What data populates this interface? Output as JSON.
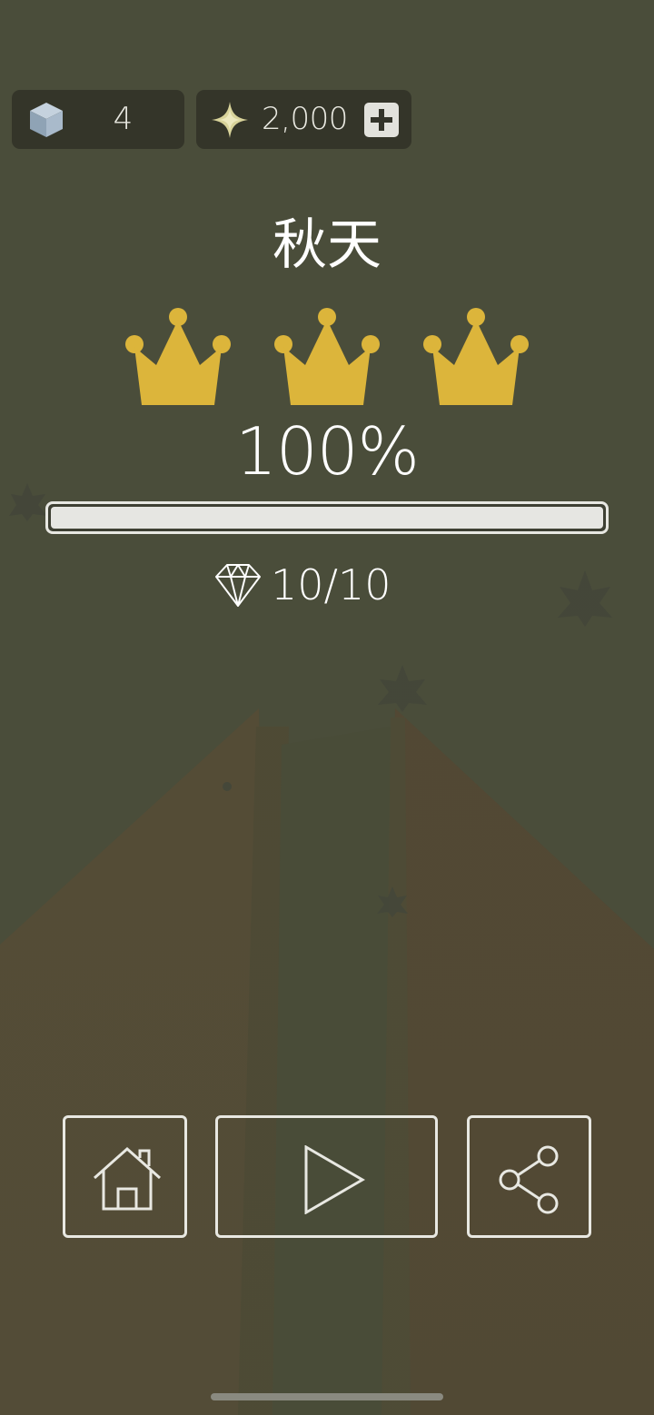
{
  "hud": {
    "cube_count": "4",
    "gem_balance": "2,000"
  },
  "level": {
    "title": "秋天",
    "crowns_earned": 3,
    "crowns_total": 3,
    "percent_label": "100%",
    "progress_fraction": 1.0,
    "diamonds_label": "10/10"
  },
  "icons": {
    "cube": "cube-icon",
    "currency": "sparkle-star-icon",
    "add": "plus-icon",
    "crown": "crown-icon",
    "diamond": "diamond-icon",
    "home": "home-icon",
    "play": "play-icon",
    "share": "share-icon"
  },
  "colors": {
    "background": "#4a4d3a",
    "crown": "#dcb53b",
    "panel": "#2d2e24",
    "text": "#ffffff"
  }
}
